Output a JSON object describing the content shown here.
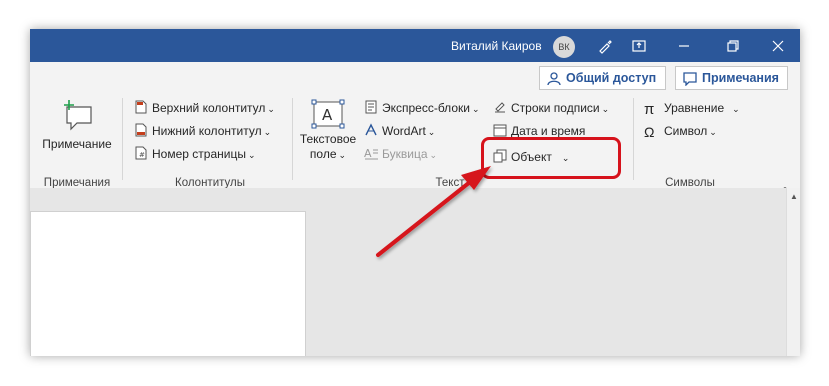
{
  "titlebar": {
    "user_name": "Виталий Каиров",
    "avatar_initials": "ВК",
    "icons": [
      "pen-icon",
      "ribbon-display-icon",
      "minimize-icon",
      "restore-icon",
      "close-icon"
    ]
  },
  "share": {
    "share_label": "Общий доступ",
    "comments_label": "Примечания"
  },
  "ribbon": {
    "groups": {
      "comments": {
        "label": "Примечания",
        "new_comment": "Примечание"
      },
      "header_footer": {
        "label": "Колонтитулы",
        "header": "Верхний колонтитул",
        "footer": "Нижний колонтитул",
        "page_number": "Номер страницы"
      },
      "text": {
        "label": "Текст",
        "text_box_line1": "Текстовое",
        "text_box_line2": "поле",
        "quick_parts": "Экспресс-блоки",
        "wordart": "WordArt",
        "drop_cap": "Буквица",
        "signature_line": "Строки подписи",
        "date_time": "Дата и время",
        "object": "Объект"
      },
      "symbols": {
        "label": "Символы",
        "equation": "Уравнение",
        "symbol": "Символ"
      }
    }
  },
  "colors": {
    "titlebar": "#2b579a",
    "highlight": "#d6121b",
    "ribbon_bg": "#f3f3f3",
    "doc_bg": "#e6e6e6"
  }
}
